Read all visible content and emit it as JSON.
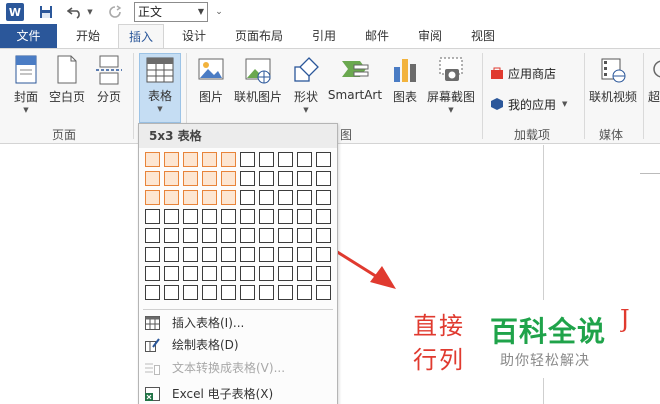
{
  "qat": {
    "style_value": "正文",
    "app_icon_letter": "W"
  },
  "tabs": [
    "文件",
    "开始",
    "插入",
    "设计",
    "页面布局",
    "引用",
    "邮件",
    "审阅",
    "视图"
  ],
  "ribbon": {
    "buttons": {
      "cover": "封面",
      "blank_page": "空白页",
      "page_break": "分页",
      "table": "表格",
      "picture": "图片",
      "online_picture": "联机图片",
      "shapes": "形状",
      "smartart": "SmartArt",
      "chart": "图表",
      "screenshot": "屏幕截图",
      "app_store": "应用商店",
      "my_apps": "我的应用",
      "online_video": "联机视频",
      "hyperlink_partial": "超"
    },
    "groups": {
      "pages": "页面",
      "illustrations_partial": "图",
      "addins": "加载项",
      "media": "媒体"
    }
  },
  "table_menu": {
    "title": "5x3 表格",
    "selected_cols": 5,
    "selected_rows": 3,
    "grid_cols": 10,
    "grid_rows": 8,
    "items": [
      {
        "label": "插入表格(I)...",
        "enabled": true,
        "icon": "insert-table-icon"
      },
      {
        "label": "绘制表格(D)",
        "enabled": true,
        "icon": "draw-table-icon"
      },
      {
        "label": "文本转换成表格(V)...",
        "enabled": false,
        "icon": "text-to-table-icon"
      },
      {
        "label": "Excel 电子表格(X)",
        "enabled": true,
        "icon": "excel-icon"
      }
    ]
  },
  "annotation": {
    "line1": "直接",
    "line2": "行列",
    "line1_end": "J",
    "color": "#e03a2f"
  },
  "watermark": {
    "title": "百科全说",
    "subtitle": "助你轻松解决"
  },
  "colors": {
    "file_tab": "#2b579a",
    "grid_highlight": "#e8843a",
    "arrow": "#e03a2f"
  }
}
